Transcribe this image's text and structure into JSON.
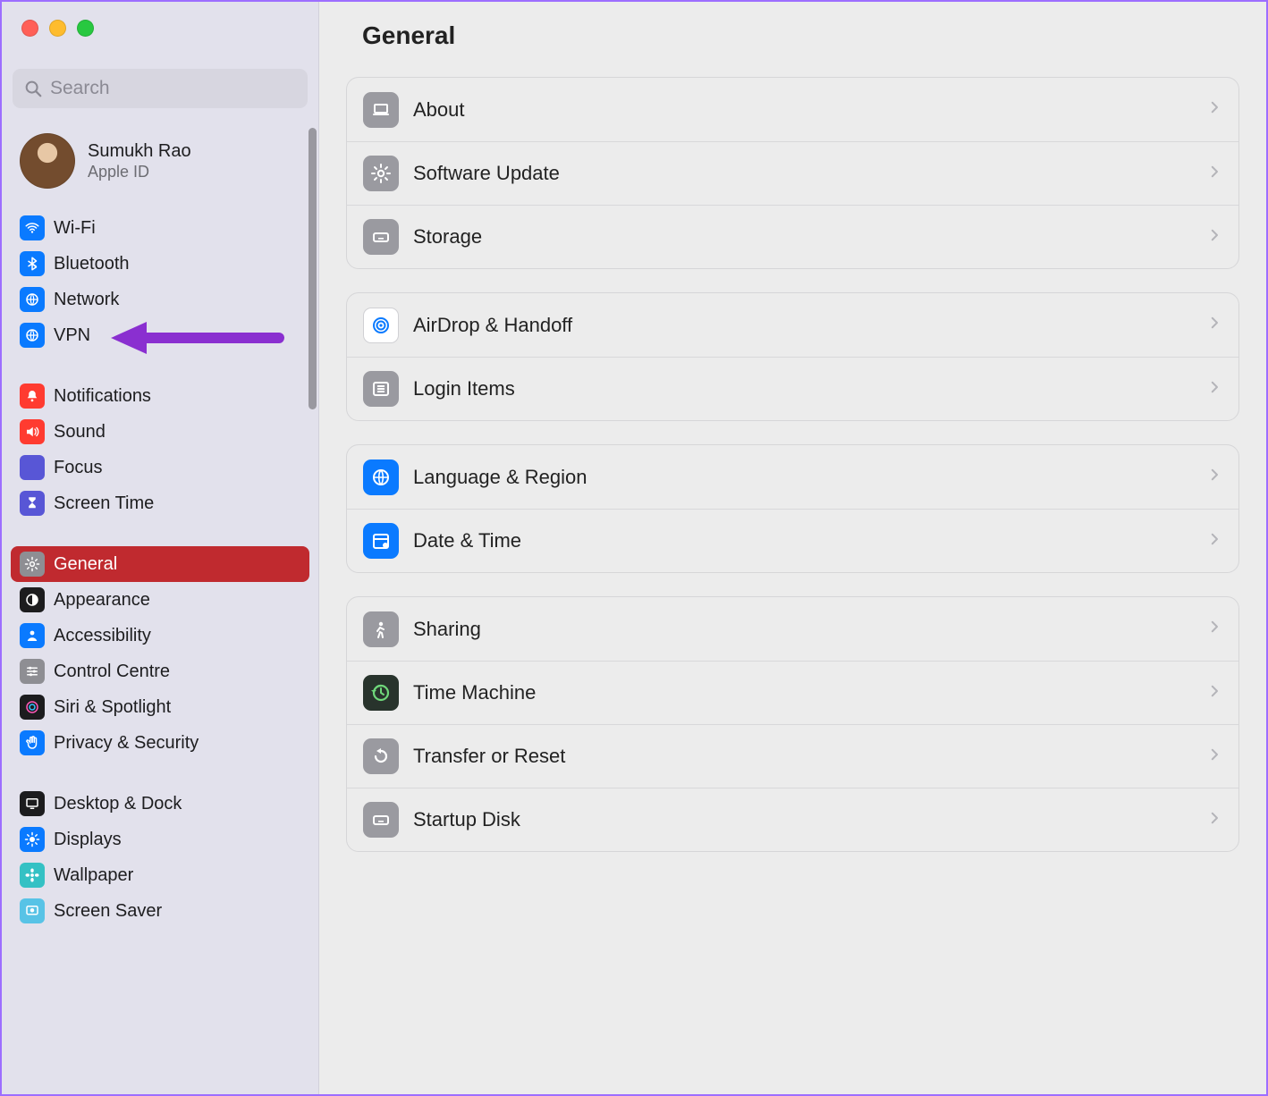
{
  "search": {
    "placeholder": "Search"
  },
  "account": {
    "name": "Sumukh Rao",
    "sub": "Apple ID"
  },
  "page_title": "General",
  "sidebar_groups": [
    {
      "gap": false,
      "items": [
        {
          "label": "Wi-Fi",
          "icon": "wifi",
          "bg": "#0a7aff",
          "fg": "#fff"
        },
        {
          "label": "Bluetooth",
          "icon": "bluetooth",
          "bg": "#0a7aff",
          "fg": "#fff"
        },
        {
          "label": "Network",
          "icon": "globe",
          "bg": "#0a7aff",
          "fg": "#fff"
        },
        {
          "label": "VPN",
          "icon": "globe",
          "bg": "#0a7aff",
          "fg": "#fff"
        }
      ]
    },
    {
      "gap": true,
      "items": [
        {
          "label": "Notifications",
          "icon": "bell",
          "bg": "#ff3b30",
          "fg": "#fff"
        },
        {
          "label": "Sound",
          "icon": "speaker",
          "bg": "#ff3b30",
          "fg": "#fff"
        },
        {
          "label": "Focus",
          "icon": "moon",
          "bg": "#5856d6",
          "fg": "#fff"
        },
        {
          "label": "Screen Time",
          "icon": "hourglass",
          "bg": "#5856d6",
          "fg": "#fff"
        }
      ]
    },
    {
      "gap": true,
      "items": [
        {
          "label": "General",
          "icon": "gear",
          "bg": "#8e8e93",
          "fg": "#fff",
          "selected": true
        },
        {
          "label": "Appearance",
          "icon": "contrast",
          "bg": "#1c1c1e",
          "fg": "#fff"
        },
        {
          "label": "Accessibility",
          "icon": "person",
          "bg": "#0a7aff",
          "fg": "#fff"
        },
        {
          "label": "Control Centre",
          "icon": "sliders",
          "bg": "#8e8e93",
          "fg": "#fff"
        },
        {
          "label": "Siri & Spotlight",
          "icon": "siri",
          "bg": "#1c1c1e",
          "fg": "#fff"
        },
        {
          "label": "Privacy & Security",
          "icon": "hand",
          "bg": "#0a7aff",
          "fg": "#fff"
        }
      ]
    },
    {
      "gap": true,
      "items": [
        {
          "label": "Desktop & Dock",
          "icon": "desktop",
          "bg": "#1c1c1e",
          "fg": "#fff"
        },
        {
          "label": "Displays",
          "icon": "sun",
          "bg": "#0a7aff",
          "fg": "#fff"
        },
        {
          "label": "Wallpaper",
          "icon": "flower",
          "bg": "#34c1c4",
          "fg": "#fff"
        },
        {
          "label": "Screen Saver",
          "icon": "screensaver",
          "bg": "#58c3e6",
          "fg": "#fff"
        }
      ]
    }
  ],
  "panels": [
    {
      "rows": [
        {
          "label": "About",
          "icon": "laptop",
          "bg": "#9a9aa0",
          "fg": "#fff"
        },
        {
          "label": "Software Update",
          "icon": "gear",
          "bg": "#9a9aa0",
          "fg": "#fff"
        },
        {
          "label": "Storage",
          "icon": "disk",
          "bg": "#9a9aa0",
          "fg": "#fff"
        }
      ]
    },
    {
      "rows": [
        {
          "label": "AirDrop & Handoff",
          "icon": "airdrop",
          "bg": "#ffffff",
          "fg": "#0a7aff",
          "border": true
        },
        {
          "label": "Login Items",
          "icon": "list",
          "bg": "#9a9aa0",
          "fg": "#fff"
        }
      ]
    },
    {
      "rows": [
        {
          "label": "Language & Region",
          "icon": "globe",
          "bg": "#0a7aff",
          "fg": "#fff"
        },
        {
          "label": "Date & Time",
          "icon": "calendar",
          "bg": "#0a7aff",
          "fg": "#fff"
        }
      ]
    },
    {
      "rows": [
        {
          "label": "Sharing",
          "icon": "personwalk",
          "bg": "#9a9aa0",
          "fg": "#fff"
        },
        {
          "label": "Time Machine",
          "icon": "timemachine",
          "bg": "#28332c",
          "fg": "#6fd67a"
        },
        {
          "label": "Transfer or Reset",
          "icon": "reset",
          "bg": "#9a9aa0",
          "fg": "#fff"
        },
        {
          "label": "Startup Disk",
          "icon": "disk",
          "bg": "#9a9aa0",
          "fg": "#fff"
        }
      ]
    }
  ],
  "arrow_color": "#8a2fd0"
}
